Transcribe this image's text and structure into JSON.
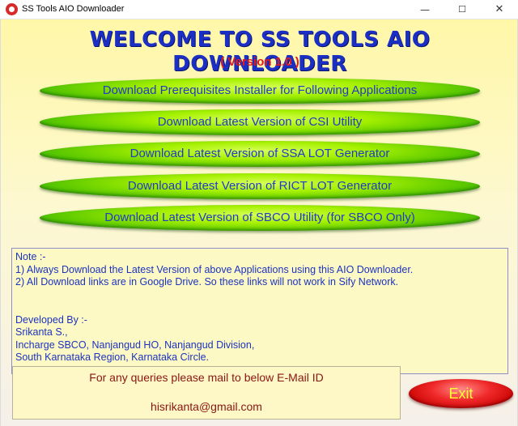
{
  "window": {
    "title": "SS Tools AIO Downloader",
    "minimize": "—",
    "maximize": "☐",
    "close": "✕"
  },
  "header": {
    "title": "WELCOME TO SS TOOLS AIO DOWNLOADER",
    "version": "( Version 1.0 )"
  },
  "buttons": [
    {
      "label": "Download Prerequisites Installer for Following Applications"
    },
    {
      "label": "Download Latest Version of CSI Utility"
    },
    {
      "label": "Download Latest Version of SSA LOT Generator"
    },
    {
      "label": "Download Latest Version of RICT LOT Generator"
    },
    {
      "label": "Download Latest Version of SBCO Utility (for SBCO Only)"
    }
  ],
  "note": {
    "lines": [
      "Note :-",
      "1) Always Download the Latest Version of above Applications using this AIO Downloader.",
      "2) All Download links are in Google Drive. So these links will not work in Sify Network.",
      "",
      "",
      "Developed By :-",
      "Srikanta S.,",
      "Incharge SBCO, Nanjangud HO, Nanjangud Division,",
      "South Karnataka Region, Karnataka Circle."
    ]
  },
  "contact": {
    "text": "For any queries please mail to below E-Mail ID",
    "email": "hisrikanta@gmail.com"
  },
  "exit": {
    "label": "Exit"
  },
  "colors": {
    "heading": "#1b2fc4",
    "version": "#e31b1b",
    "button_green": "#7be000",
    "exit_red": "#e01010",
    "exit_text": "#ffff33"
  }
}
